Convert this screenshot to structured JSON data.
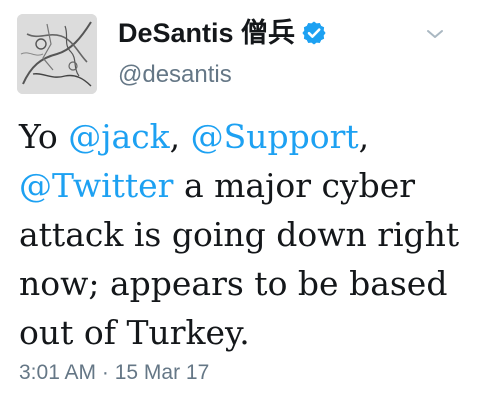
{
  "author": {
    "display_name": "DeSantis 僧兵",
    "handle": "@desantis",
    "verified": true,
    "avatar_icon": "sketch-drawing-avatar"
  },
  "menu": {
    "icon": "chevron-down-icon"
  },
  "tweet": {
    "segments": [
      {
        "text": "Yo ",
        "type": "plain"
      },
      {
        "text": "@jack",
        "type": "mention"
      },
      {
        "text": ", ",
        "type": "plain"
      },
      {
        "text": "@Support",
        "type": "mention"
      },
      {
        "text": ", ",
        "type": "plain"
      },
      {
        "text": "@Twitter",
        "type": "mention"
      },
      {
        "text": " a major cyber attack is going down right now; appears to be based out of Turkey.",
        "type": "plain"
      }
    ]
  },
  "meta": {
    "timestamp": "3:01 AM · 15 Mar 17"
  },
  "colors": {
    "mention": "#1da1f2",
    "verified": "#1da1f2",
    "secondary_text": "#657786",
    "primary_text": "#14171a"
  }
}
